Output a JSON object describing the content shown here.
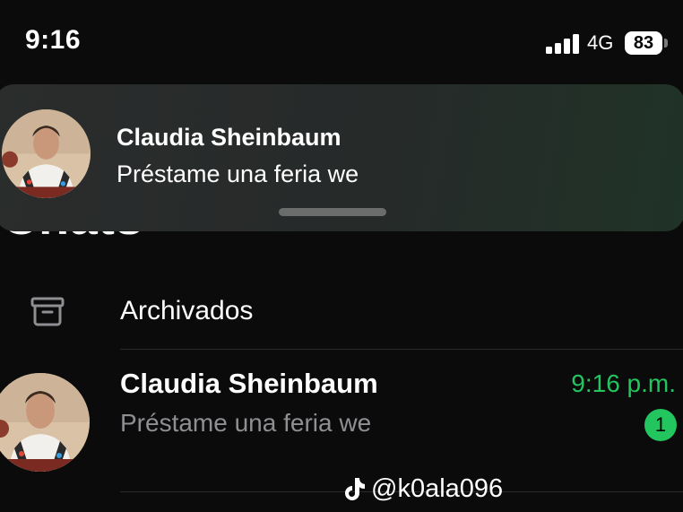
{
  "status_bar": {
    "time": "9:16",
    "network": "4G",
    "battery_level": "83"
  },
  "notification": {
    "sender": "Claudia Sheinbaum",
    "message": "Préstame una feria we",
    "avatar_icon": "person-photo-avatar"
  },
  "page": {
    "title": "Chats"
  },
  "archived": {
    "label": "Archivados",
    "icon": "archive-box-icon"
  },
  "chats": [
    {
      "name": "Claudia Sheinbaum",
      "preview": "Préstame una feria we",
      "time": "9:16 p.m.",
      "unread_count": "1"
    }
  ],
  "watermark": {
    "handle": "@k0ala096",
    "icon": "tiktok-icon"
  },
  "colors": {
    "background": "#0b0b0b",
    "accent_green": "#22c55e",
    "muted_text": "#8e8e93"
  }
}
